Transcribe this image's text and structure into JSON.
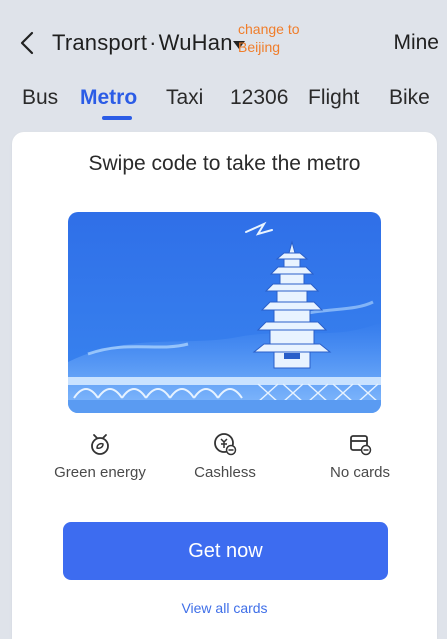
{
  "header": {
    "title_prefix": "Transport",
    "title_dot": "·",
    "city": "WuHan",
    "annotation": "change to\nBeijing",
    "right_label": "Mine"
  },
  "tabs": [
    {
      "label": "Bus",
      "active": false
    },
    {
      "label": "Metro",
      "active": true
    },
    {
      "label": "Taxi",
      "active": false
    },
    {
      "label": "12306",
      "active": false
    },
    {
      "label": "Flight",
      "active": false
    },
    {
      "label": "Bike",
      "active": false
    }
  ],
  "card": {
    "title": "Swipe code to take the metro",
    "features": [
      {
        "icon": "green-energy-icon",
        "label": "Green energy"
      },
      {
        "icon": "cashless-icon",
        "label": "Cashless"
      },
      {
        "icon": "no-cards-icon",
        "label": "No cards"
      }
    ],
    "cta_label": "Get now",
    "link_label": "View all cards"
  },
  "colors": {
    "accent": "#2b5ce6",
    "button": "#3d6cf0",
    "annotation": "#f07d2a",
    "background": "#dfe3ea"
  }
}
